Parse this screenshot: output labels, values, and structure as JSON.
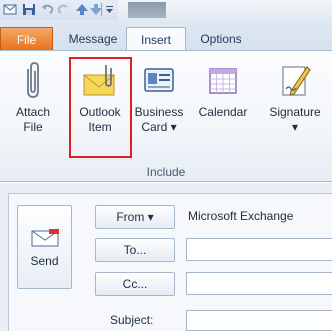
{
  "tabs": {
    "file": "File",
    "message": "Message",
    "insert": "Insert",
    "options": "Options"
  },
  "ribbon": {
    "buttons": [
      {
        "label": "Attach\nFile",
        "icon": "paperclip-icon"
      },
      {
        "label": "Outlook\nItem",
        "icon": "envelope-icon"
      },
      {
        "label": "Business\nCard ▾",
        "icon": "business-card-icon"
      },
      {
        "label": "Calendar",
        "icon": "calendar-icon"
      },
      {
        "label": "Signature\n▾",
        "icon": "signature-icon"
      }
    ],
    "group_label": "Include"
  },
  "header": {
    "send_label": "Send",
    "from_label": "From ▾",
    "from_value": "Microsoft Exchange",
    "to_label": "To...",
    "cc_label": "Cc...",
    "subject_label": "Subject:"
  },
  "colors": {
    "file_tab": "#e86e16",
    "highlight": "#e02020"
  }
}
